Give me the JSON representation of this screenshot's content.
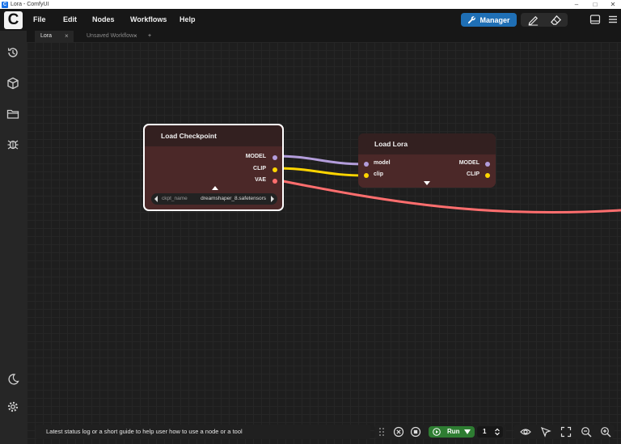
{
  "window": {
    "title": "Lora - ComfyUI",
    "app_icon_letter": "C"
  },
  "menubar": {
    "logo_letter": "C",
    "items": [
      {
        "label": "File"
      },
      {
        "label": "Edit"
      },
      {
        "label": "Nodes"
      },
      {
        "label": "Workflows"
      },
      {
        "label": "Help"
      }
    ],
    "manager_label": "Manager",
    "icons": [
      "pen-icon",
      "eraser-icon",
      "panel-toggle-icon",
      "hamburger-menu-icon"
    ],
    "accent_color": "#1f6fb5"
  },
  "tabs": [
    {
      "label": "Lora",
      "active": true
    },
    {
      "label": "Unsaved Workflow",
      "active": false
    }
  ],
  "new_tab_label": "+",
  "sidebar": {
    "icons": [
      "history-icon",
      "cube-icon",
      "folder-icon",
      "bug-icon",
      "moon-icon",
      "settings-icon"
    ]
  },
  "nodes": {
    "checkpoint": {
      "title": "Load Checkpoint",
      "outputs": [
        {
          "label": "MODEL",
          "color": "#b39ddb"
        },
        {
          "label": "CLIP",
          "color": "#ffd500"
        },
        {
          "label": "VAE",
          "color": "#ff6e6e"
        }
      ],
      "widget": {
        "name": "ckpt_name",
        "value": "dreamshaper_8.safetensors"
      },
      "selected": true
    },
    "lora": {
      "title": "Load Lora",
      "inputs": [
        {
          "label": "model",
          "color": "#b39ddb"
        },
        {
          "label": "clip",
          "color": "#ffd500"
        }
      ],
      "outputs": [
        {
          "label": "MODEL",
          "color": "#b39ddb"
        },
        {
          "label": "CLIP",
          "color": "#ffd500"
        }
      ]
    }
  },
  "links": [
    {
      "from": "checkpoint.MODEL",
      "to": "lora.model",
      "color": "#b39ddb"
    },
    {
      "from": "checkpoint.CLIP",
      "to": "lora.clip",
      "color": "#ffd500"
    },
    {
      "from": "checkpoint.VAE",
      "to": "offscreen",
      "color": "#ff6e6e"
    }
  ],
  "statusbar": {
    "text": "Latest status log or a short guide to help user how to use a node or a tool"
  },
  "queue": {
    "run_label": "Run",
    "batch_count": "1",
    "run_color": "#2e7d32"
  },
  "view_controls": {
    "icons": [
      "eye-icon",
      "pointer-icon",
      "fit-view-icon",
      "zoom-out-icon",
      "zoom-in-icon"
    ]
  }
}
